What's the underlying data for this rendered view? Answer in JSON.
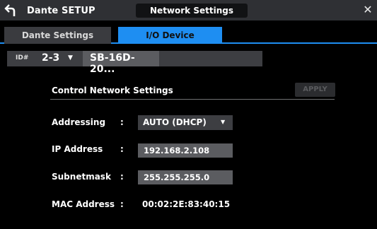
{
  "header": {
    "app_title": "Dante SETUP",
    "screen_title": "Network Settings",
    "back_icon": "back-arrow-icon",
    "close_icon": "close-icon",
    "close_glyph": "✕"
  },
  "tabs": [
    {
      "label": "Dante Settings",
      "active": false
    },
    {
      "label": "I/O Device",
      "active": true
    }
  ],
  "device": {
    "id_label": "ID#",
    "id_value": "2-3",
    "dropdown_glyph": "▼",
    "name": "SB-16D-20..."
  },
  "section": {
    "title": "Control Network Settings",
    "apply_label": "APPLY"
  },
  "rows": {
    "addressing": {
      "label": "Addressing",
      "colon": ":",
      "value": "AUTO (DHCP)",
      "caret": "▼"
    },
    "ip": {
      "label": "IP Address",
      "colon": ":",
      "value": "192.168.2.108"
    },
    "subnet": {
      "label": "Subnetmask",
      "colon": ":",
      "value": "255.255.255.0"
    },
    "mac": {
      "label": "MAC Address",
      "colon": ":",
      "value": "00:02:2E:83:40:15"
    }
  },
  "colors": {
    "accent": "#1e8ef2",
    "background": "#000000",
    "panel": "#3d3e42",
    "field": "#5b5c60"
  }
}
